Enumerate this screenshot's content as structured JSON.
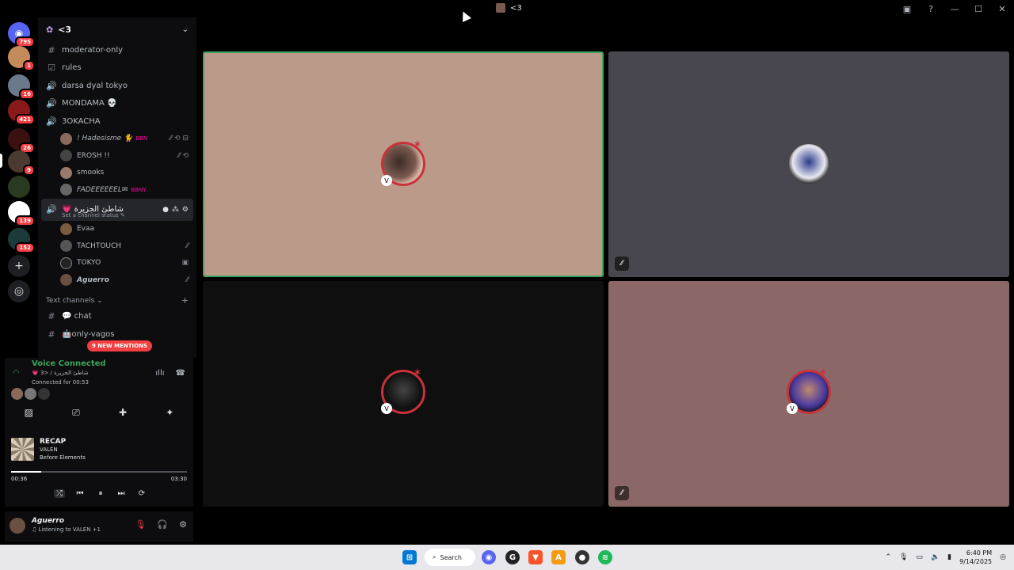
{
  "window": {
    "title": "<3"
  },
  "colors": {
    "accent_green": "#3ba55c",
    "danger_red": "#f23f42",
    "tile1": "#bc9a89",
    "tile2": "#48474f",
    "tile3": "#0f0f0f",
    "tile4": "#8c6767"
  },
  "rail": {
    "servers": [
      {
        "name": "direct-messages",
        "badge": "795"
      },
      {
        "name": "server-1",
        "badge": "1"
      },
      {
        "name": "server-2",
        "badge": "16"
      },
      {
        "name": "server-3",
        "badge": "421"
      },
      {
        "name": "server-4",
        "badge": "26"
      },
      {
        "name": "server-5",
        "badge": "9"
      },
      {
        "name": "server-6",
        "badge": ""
      },
      {
        "name": "server-7",
        "badge": "139"
      },
      {
        "name": "server-8",
        "badge": "152"
      }
    ]
  },
  "sidebar": {
    "server_name": "<3",
    "channels": [
      {
        "name": "moderator-only",
        "icon": "#"
      },
      {
        "name": "rules",
        "icon": "☑"
      },
      {
        "name": "darsa dyal tokyo",
        "icon": "🔊"
      },
      {
        "name": "MONDAMA 💀",
        "icon": "🔊"
      },
      {
        "name": "3OKACHA",
        "icon": "🔊"
      }
    ],
    "voice_users_1": [
      {
        "name": "! Hadesisme 🐈",
        "tag": "BBN",
        "icons": "⁄⁄ ⟲ ⊟"
      },
      {
        "name": "EROSH !!",
        "tag": "",
        "icons": "⁄⁄ ⟲"
      },
      {
        "name": "smooks",
        "tag": "",
        "icons": ""
      },
      {
        "name": "FADEEEEEEL✉",
        "tag": "BBNY",
        "icons": ""
      }
    ],
    "active_channel": {
      "name": "💗 شاطئ الجزيرة",
      "status": "Set a channel status ✎"
    },
    "voice_users_2": [
      {
        "name": "Evaa",
        "icons": ""
      },
      {
        "name": "TACHTOUCH",
        "icons": "⁄⁄"
      },
      {
        "name": "TOKYO",
        "icons": "▣"
      },
      {
        "name": "Aguerro",
        "icons": "⁄⁄"
      }
    ],
    "category": "Text channels",
    "text_channels": [
      {
        "name": "💬 chat",
        "icon": "#"
      },
      {
        "name": "🤖only-vagos",
        "icon": "#"
      }
    ],
    "mentions": "9 NEW MENTIONS"
  },
  "voice": {
    "title": "Voice Connected",
    "subtitle": "💗 شاطئ الجزيرة / <3",
    "duration": "Connected for 00:53"
  },
  "music": {
    "title": "RECAP",
    "artist": "VALEN",
    "album": "Before Elements",
    "elapsed": "00:36",
    "total": "03:30",
    "progress": 0.17
  },
  "user": {
    "name": "Aguerro",
    "status": "♫ Listening to VALEN +1"
  },
  "taskbar": {
    "search": "Search",
    "time": "6:40 PM",
    "date": "9/14/2025"
  }
}
